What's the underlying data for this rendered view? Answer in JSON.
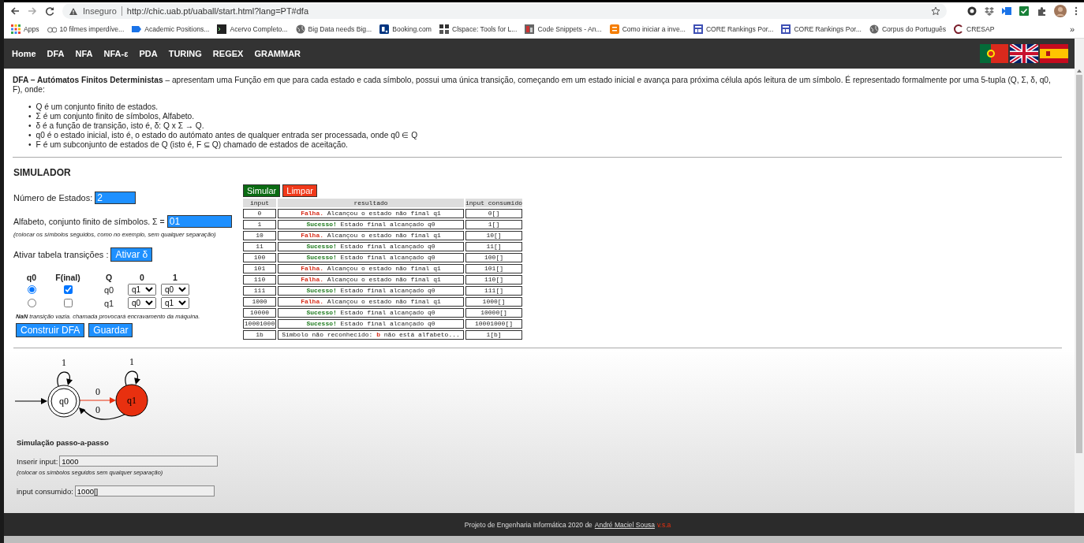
{
  "browser": {
    "security": "Inseguro",
    "url": "http://chic.uab.pt/uaball/start.html?lang=PT#dfa",
    "more": "»",
    "bookmarks": [
      {
        "label": "Apps"
      },
      {
        "label": "10 filmes imperdíve..."
      },
      {
        "label": "Academic Positions..."
      },
      {
        "label": "Acervo Completo..."
      },
      {
        "label": "Big Data needs Big..."
      },
      {
        "label": "Booking.com"
      },
      {
        "label": "Clspace: Tools for L..."
      },
      {
        "label": "Code Snippets - An..."
      },
      {
        "label": "Como iniciar a inve..."
      },
      {
        "label": "CORE Rankings Por..."
      },
      {
        "label": "CORE Rankings Por..."
      },
      {
        "label": "Corpus do Português"
      },
      {
        "label": "CRESAP"
      }
    ]
  },
  "nav": {
    "items": [
      {
        "label": "Home"
      },
      {
        "label": "DFA"
      },
      {
        "label": "NFA"
      },
      {
        "label": "NFA-ε"
      },
      {
        "label": "PDA"
      },
      {
        "label": "TURING"
      },
      {
        "label": "REGEX"
      },
      {
        "label": "GRAMMAR"
      }
    ]
  },
  "intro": {
    "lead": "**DFA – Autómatos Finitos Deterministas** – apresentam uma Função em que para cada estado e cada símbolo, possui uma única transição, começando em um estado inicial e avança para próxima célula após leitura de um símbolo. É representado formalmente por uma 5-tupla (Q, Σ, δ, q0, F), onde:",
    "marker": "•",
    "bullets": [
      "Q é um conjunto finito de estados.",
      "Σ é um conjunto finito de símbolos, Alfabeto.",
      "δ é a função de transição, isto é, δ: Q x Σ → Q.",
      "q0 é o estado inicial, isto é, o estado do autómato antes de qualquer entrada ser processada, onde q0 ∈ Q",
      "F é um subconjunto de estados de Q (isto é, F ⊆ Q) chamado de estados de aceitação."
    ]
  },
  "simulator": {
    "title": "SIMULADOR",
    "states_label": "Número de Estados:",
    "states_value": "2",
    "alphabet_label": "Alfabeto, conjunto finito de símbolos. Σ =",
    "alphabet_value": "01",
    "alphabet_hint": "(colocar os símbolos seguidos, como no exemplo, sem qualquer separação)",
    "activate_label": "Ativar tabela transições :",
    "activate_button": "Ativar δ",
    "transitions": {
      "columns": [
        "q0",
        "F(inal)",
        "Q",
        "0",
        "1"
      ],
      "rows": [
        {
          "initial": true,
          "final": true,
          "state": "q0",
          "on_0": "q1",
          "on_1": "q0"
        },
        {
          "initial": false,
          "final": false,
          "state": "q1",
          "on_0": "q0",
          "on_1": "q1"
        }
      ]
    },
    "nan_note": "**NaN** transição vazia. chamada provocará encravamento da máquina.",
    "buttons": [
      "Construir DFA",
      "Guardar"
    ]
  },
  "results": {
    "buttons": [
      {
        "label": "Simular",
        "kind": "simulate"
      },
      {
        "label": "Limpar",
        "kind": "clear"
      }
    ],
    "columns": [
      "input",
      "resultado",
      "input consumido"
    ],
    "rows": [
      {
        "input": "0",
        "kind": "fail",
        "status": "Falha.",
        "message": "Alcançou o estado não final q1",
        "consumed": "0[]"
      },
      {
        "input": "1",
        "kind": "success",
        "status": "Sucesso!",
        "message": "Estado final alcançado q0",
        "consumed": "1[]"
      },
      {
        "input": "10",
        "kind": "fail",
        "status": "Falha.",
        "message": "Alcançou o estado não final q1",
        "consumed": "10[]"
      },
      {
        "input": "11",
        "kind": "success",
        "status": "Sucesso!",
        "message": "Estado final alcançado q0",
        "consumed": "11[]"
      },
      {
        "input": "100",
        "kind": "success",
        "status": "Sucesso!",
        "message": "Estado final alcançado q0",
        "consumed": "100[]"
      },
      {
        "input": "101",
        "kind": "fail",
        "status": "Falha.",
        "message": "Alcançou o estado não final q1",
        "consumed": "101[]"
      },
      {
        "input": "110",
        "kind": "fail",
        "status": "Falha.",
        "message": "Alcançou o estado não final q1",
        "consumed": "110[]"
      },
      {
        "input": "111",
        "kind": "success",
        "status": "Sucesso!",
        "message": "Estado final alcançado q0",
        "consumed": "111[]"
      },
      {
        "input": "1000",
        "kind": "fail",
        "status": "Falha.",
        "message": "Alcançou o estado não final q1",
        "consumed": "1000[]"
      },
      {
        "input": "10000",
        "kind": "success",
        "status": "Sucesso!",
        "message": "Estado final alcançado q0",
        "consumed": "10000[]"
      },
      {
        "input": "10001000",
        "kind": "success",
        "status": "Sucesso!",
        "message": "Estado final alcançado q0",
        "consumed": "10001000[]"
      },
      {
        "input": "1b",
        "kind": "unknown",
        "message": "Símbolo não reconhecido:",
        "symbol": "b",
        "rest": "não está alfabeto...",
        "consumed": "1[b]"
      }
    ]
  },
  "diagram": {
    "nodes": [
      {
        "label": "q0",
        "initial": true,
        "final": true,
        "active": false
      },
      {
        "label": "q1",
        "initial": false,
        "final": false,
        "active": true
      }
    ],
    "edges": [
      {
        "label": "1",
        "active": false
      },
      {
        "label": "0",
        "active": true
      },
      {
        "label": "0",
        "active": false
      },
      {
        "label": "1",
        "active": false
      }
    ]
  },
  "stepper": {
    "title": "Simulação passo-a-passo",
    "input_label": "Inserir input:",
    "input_value": "1000",
    "hint": "(colocar os símbolos seguidos sem qualquer separação)",
    "consumed_label": "input consumido:",
    "consumed_value": "1000[]"
  },
  "footer": {
    "text": "Projeto de Engenharia Informática 2020 de",
    "author": "André Maciel Sousa",
    "version": "v.s.a"
  }
}
